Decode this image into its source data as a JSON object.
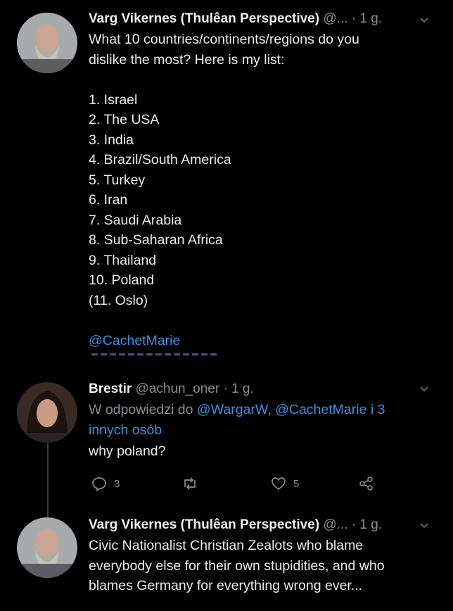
{
  "tweet1": {
    "name": "Varg Vikernes (Thulêan Perspective)",
    "handle": "@...",
    "time": "· 1 g.",
    "intro_line1": "What 10 countries/continents/regions do you",
    "intro_line2": "dislike the most? Here is my list:",
    "list": [
      "1. Israel",
      "2. The USA",
      "3. India",
      "4. Brazil/South America",
      "5. Turkey",
      "6. Iran",
      "7. Saudi Arabia",
      "8. Sub-Saharan Africa",
      "9. Thailand",
      "10. Poland",
      "(11. Oslo)"
    ],
    "mention": "@CachetMarie"
  },
  "tweet2": {
    "name": "Brestir",
    "handle": "@achun_oner",
    "time": "· 1 g.",
    "reply_prefix": "W odpowiedzi do ",
    "reply_users": "@WargarW, @CachetMarie i 3",
    "reply_more": "innych osób",
    "text": "why poland?",
    "reply_count": "3",
    "like_count": "5"
  },
  "tweet3": {
    "name": "Varg Vikernes (Thulêan Perspective)",
    "handle": "@...",
    "time": "· 1 g.",
    "lines": [
      "Civic Nationalist Christian Zealots who blame",
      "everybody else for their own stupidities, and who",
      "blames Germany for everything wrong ever..."
    ]
  },
  "colors": {
    "background": "#000000",
    "link": "#3d8fe0",
    "muted": "#8a8d91"
  },
  "icons": [
    "reply-icon",
    "retweet-icon",
    "like-icon",
    "share-icon",
    "chevron-down-icon"
  ]
}
